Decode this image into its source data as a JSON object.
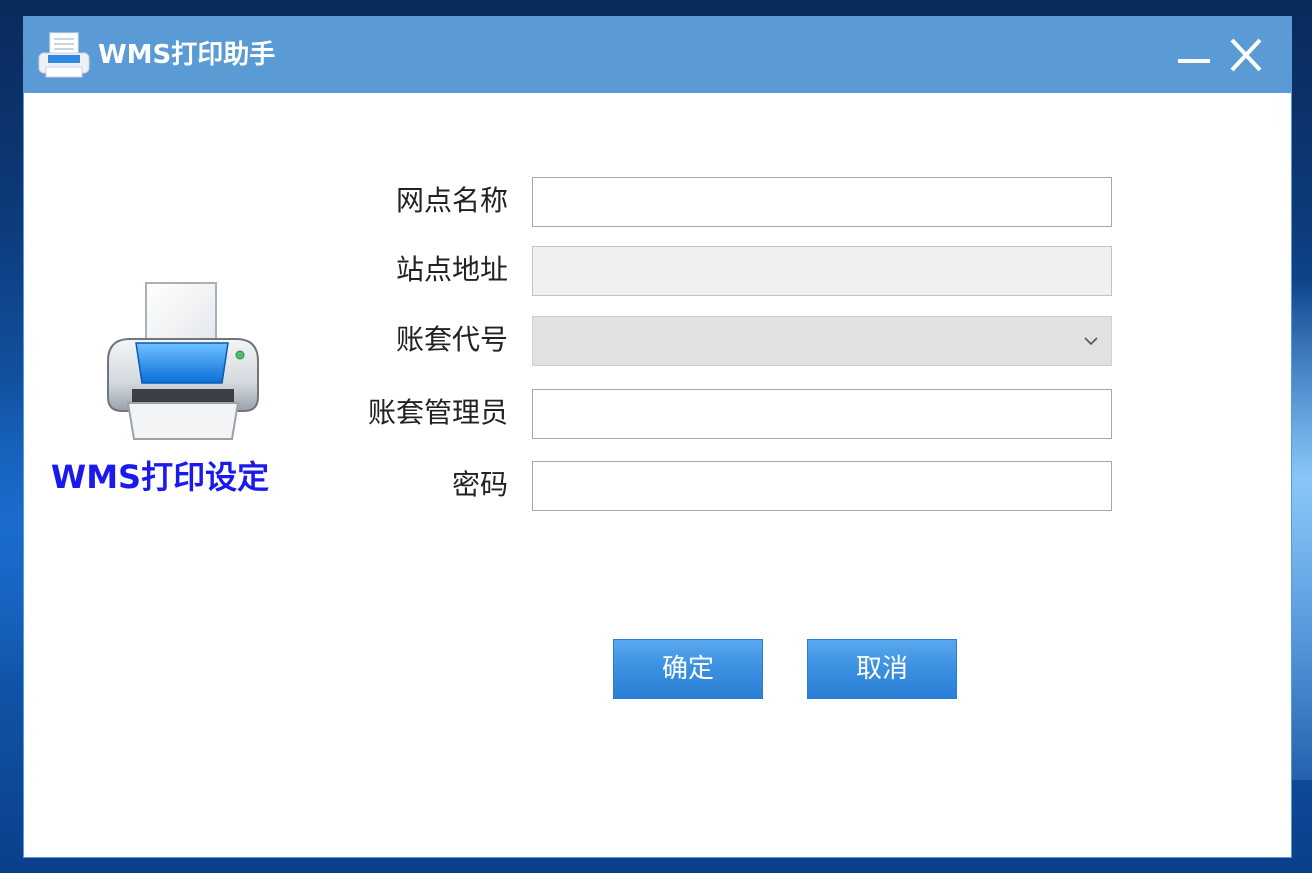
{
  "window": {
    "title": "WMS打印助手",
    "minimize_icon": "minimize-icon",
    "close_icon": "close-icon",
    "title_icon": "printer-icon"
  },
  "branding": {
    "caption": "WMS打印设定",
    "caption_color": "#1a1aee",
    "illustration_icon": "printer-icon"
  },
  "form": {
    "fields": [
      {
        "label": "网点名称",
        "value": "",
        "state": "editable"
      },
      {
        "label": "站点地址",
        "value": "",
        "state": "readonly"
      },
      {
        "label": "账套代号",
        "value": "",
        "state": "dropdown"
      },
      {
        "label": "账套管理员",
        "value": "",
        "state": "editable"
      },
      {
        "label": "密码",
        "value": "",
        "state": "password"
      }
    ]
  },
  "buttons": {
    "ok_label": "确定",
    "cancel_label": "取消"
  },
  "colors": {
    "titlebar": "#5a9bd6",
    "button": "#3a8fe0"
  }
}
